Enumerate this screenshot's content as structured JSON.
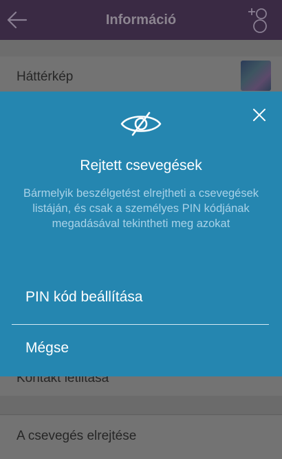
{
  "navbar": {
    "title": "Információ",
    "back_icon": "back-arrow-icon",
    "add_contact_icon": "add-contact-icon"
  },
  "background": {
    "wallpaper_label": "Háttérkép",
    "row_block_contact": "Kontakt letiltása",
    "row_hide_chat": "A csevegés elrejtése"
  },
  "modal": {
    "icon": "eye-slash-icon",
    "title": "Rejtett csevegések",
    "description": "Bármelyik beszélgetést elrejtheti a csevegések listáján, és csak a személyes PIN kódjának megadásával tekintheti meg azokat",
    "primary_action": "PIN kód beállítása",
    "cancel_action": "Mégse",
    "close_icon": "close-icon"
  },
  "colors": {
    "modal_background": "#2586b0",
    "navbar_background": "#3a2a44",
    "overlay_dim": "#6f6f6f"
  }
}
